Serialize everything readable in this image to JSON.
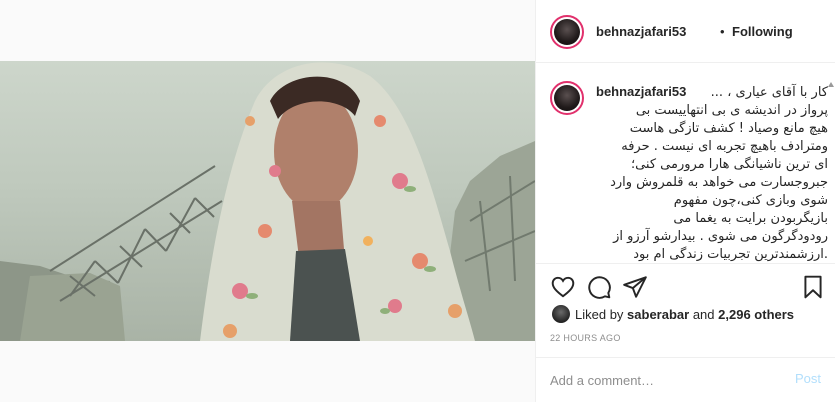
{
  "post": {
    "username": "behnazjafari53",
    "separator": "•",
    "follow_label": "Following",
    "caption_username": "behnazjafari53",
    "caption_text": "کار با آقای عیاری ، ...\nپرواز در اندیشه ی بی انتهاییست بی\nهیچ مانع وصیاد ! کشف تازگی هاست\nومترادف باهیچ تجربه ای نیست . حرفه\nای ترین ناشیانگی هارا مرورمی کنی؛\nجبروجسارت می خواهد به قلمروش وارد\nشوی وبازی کنی،چون مفهوم\nبازیگربودن برایت به یغما می\nرودودگرگون می شوی . بیدارشو آرزو از\n.ارزشمندترین تجربیات زندگی ام بود\nتسلیت به پر نشینان عزیزم که هنوز",
    "liked_by_prefix": "Liked by",
    "liked_by_user": "saberabar",
    "liked_by_and": "and",
    "liked_by_count": "2,296 others",
    "timestamp": "22 HOURS AGO",
    "comment_placeholder": "Add a comment…",
    "post_label": "Post"
  },
  "icons": {
    "like": "heart-icon",
    "comment": "comment-bubble-icon",
    "share": "paper-plane-icon",
    "save": "bookmark-icon"
  },
  "colors": {
    "text": "#262626",
    "muted": "#8e8e8e",
    "border": "#efefef",
    "post_disabled": "#b2dffc",
    "story_ring": "#e1306c"
  }
}
